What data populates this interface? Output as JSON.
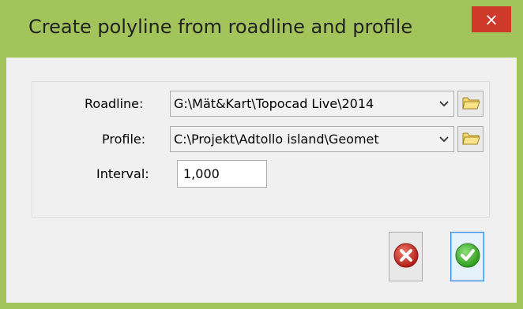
{
  "window": {
    "title": "Create polyline from roadline and profile",
    "close_glyph": "×",
    "frame_color": "#a3c45a",
    "close_color": "#cf3b2a"
  },
  "form": {
    "roadline": {
      "label": "Roadline:",
      "value": "G:\\Mät&Kart\\Topocad Live\\2014",
      "browse_icon": "folder-icon"
    },
    "profile": {
      "label": "Profile:",
      "value": "C:\\Projekt\\Adtollo island\\Geomet",
      "browse_icon": "folder-icon"
    },
    "interval": {
      "label": "Interval:",
      "value": "1,000"
    }
  },
  "buttons": {
    "cancel_icon": "cancel-icon",
    "ok_icon": "ok-icon"
  }
}
